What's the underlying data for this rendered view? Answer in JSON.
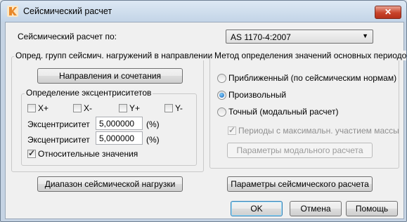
{
  "window": {
    "title": "Сейсмический расчет",
    "close_label": "✕"
  },
  "header": {
    "calc_by_label": "Сейсмический расчет по:",
    "calc_by_value": "AS 1170-4:2007"
  },
  "left_group": {
    "title": "Опред. групп сейсмич. нагружений в направлении",
    "directions_button": "Направления и сочетания",
    "ecc_group_title": "Определение эксцентриситетов",
    "checkboxes": [
      {
        "label": "X+",
        "checked": false
      },
      {
        "label": "X-",
        "checked": false
      },
      {
        "label": "Y+",
        "checked": false
      },
      {
        "label": "Y-",
        "checked": false
      }
    ],
    "ecc1": {
      "label": "Эксцентриситет",
      "value": "5,000000",
      "unit": "(%)"
    },
    "ecc2": {
      "label": "Эксцентриситет",
      "value": "5,000000",
      "unit": "(%)"
    },
    "relative_label": "Относительные значения",
    "relative_checked": true
  },
  "right_group": {
    "title": "Метод определения значений основных периодов",
    "radios": [
      {
        "label": "Приближенный (по сейсмическим нормам)",
        "selected": false
      },
      {
        "label": "Произвольный",
        "selected": true
      },
      {
        "label": "Точный (модальный расчет)",
        "selected": false
      }
    ],
    "max_periods_label": "Периоды с максимальн. участием массы",
    "modal_params_button": "Параметры модального расчета"
  },
  "bottom": {
    "range_button": "Диапазон сейсмической нагрузки",
    "params_button": "Параметры сейсмического расчета",
    "ok": "OK",
    "cancel": "Отмена",
    "help": "Помощь"
  },
  "colors": {
    "accent": "#3c7fb1",
    "close": "#c8432a",
    "icon": "#e8882a"
  }
}
